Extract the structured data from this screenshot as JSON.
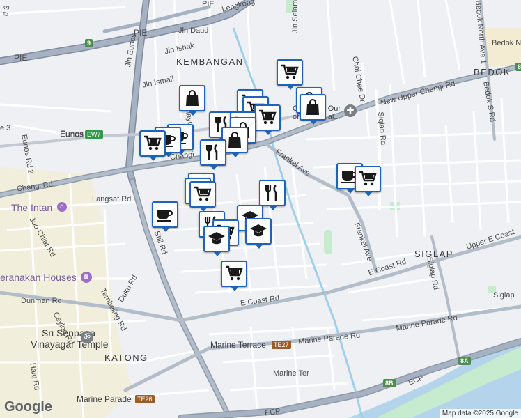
{
  "map": {
    "areas": {
      "kembangan": "KEMBANGAN",
      "bedok": "BEDOK",
      "siglap": "SIGLAP",
      "katong": "KATONG"
    },
    "roads": {
      "pie": "PIE",
      "pie2": "PIE",
      "pie3": "PIE",
      "jln_eunos": "Jln Eunos",
      "jln_daud": "Jln Daud",
      "jln_ishak": "Jln Ishak",
      "jln_ismail": "Jln Ismail",
      "jln_selamat": "Jln Selamat",
      "lengkong": "Lengkong",
      "lor_melayu": "Lor Melayu",
      "chai_chee": "Chai Chee Dr",
      "bedok_north": "Bedok North Ave 1",
      "bedok_n_rd": "Bedok N",
      "bedok_s": "Bedok S Rd",
      "new_upper_changi": "New Upper Changi Rd",
      "siglap_rd": "Siglap Rd",
      "siglap_rd2": "Siglap Rd",
      "frankel": "Frankel Ave",
      "frankel2": "Frankel Ave",
      "changi_rd": "Changi Rd",
      "changi_rd2": "Changi",
      "eunos": "Eunos",
      "eunos_rd2": "Eunos Rd 2",
      "rd3": "d 3",
      "rd3b": "e 3",
      "langsat": "Langsat Rd",
      "joo_chiat": "Joo Chiat Rd",
      "still_rd": "Still Rd",
      "dunman": "Dunman Rd",
      "duku": "Duku Rd",
      "tembeling": "Tembeling Rd",
      "ceylon": "Ceylon Rd",
      "haig": "Haig Rd",
      "e_coast": "E Coast Rd",
      "e_coast2": "E Coast Rd",
      "upper_e_coast": "Upper E Coast",
      "marine_parade_rd": "Marine Parade Rd",
      "marine_ter": "Marine Ter",
      "ecp": "ECP",
      "ecp2": "ECP",
      "siglap_right": "Siglap"
    },
    "pois": {
      "intan": "The Intan",
      "peranakan": "eranakan Houses",
      "senpaga1": "Sri Senpaga",
      "senpaga2": "Vinayagar Temple",
      "church1": "Church of Our",
      "church2": "of Perpetual..."
    },
    "stations": {
      "eunos": "Eunos",
      "eunos_code": "EW7",
      "marine_terrace": "Marine Terrace",
      "marine_terrace_code": "TE27",
      "marine_parade": "Marine Parade",
      "marine_parade_code": "TE26"
    },
    "road_badges": {
      "b9": "9",
      "b8": "8",
      "b8a": "8A",
      "b8b": "8B"
    },
    "attribution": "Map data ©2025 Google",
    "google_logo": "Google",
    "colors": {
      "marker_border": "#1e63b8",
      "road_major": "#8e9aaa",
      "water": "#b3d4ea",
      "park": "#c7ebcf"
    }
  }
}
